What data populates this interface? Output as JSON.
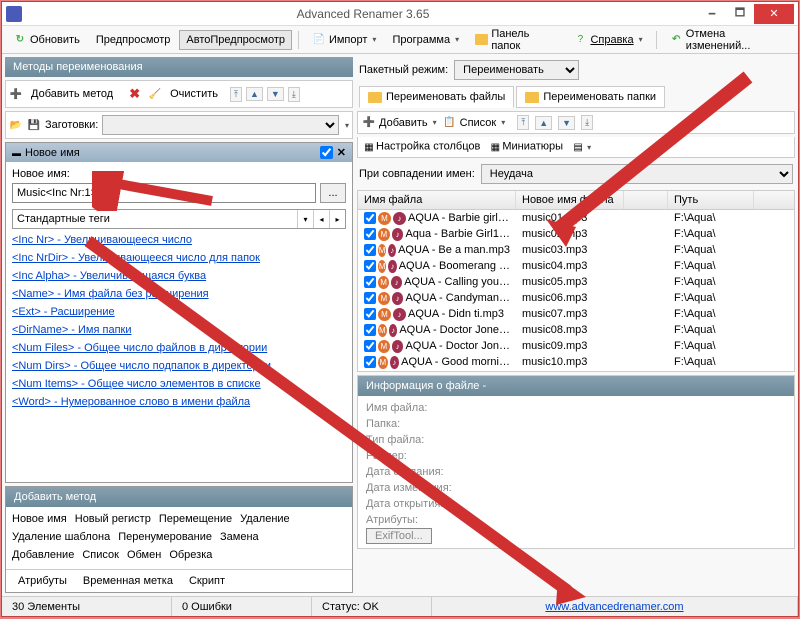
{
  "title": "Advanced Renamer 3.65",
  "toolbar": {
    "refresh": "Обновить",
    "preview": "Предпросмотр",
    "autopreview": "АвтоПредпросмотр",
    "import": "Импорт",
    "program": "Программа",
    "folders_panel": "Панель папок",
    "help": "Справка",
    "undo": "Отмена изменений..."
  },
  "methods": {
    "header": "Методы переименования",
    "add": "Добавить метод",
    "clear": "Очистить",
    "presets_label": "Заготовки:"
  },
  "new_name": {
    "title": "Новое имя",
    "label": "Новое имя:",
    "value": "Music<Inc Nr:1>",
    "dots": "...",
    "std_tags": "Стандартные теги",
    "tags": [
      "<Inc Nr> - Увеличивающееся число",
      "<Inc NrDir> - Увеличивающееся число для папок",
      "<Inc Alpha> - Увеличивающаяся буква",
      "<Name> - Имя файла без расширения",
      "<Ext> - Расширение",
      "<DirName> - Имя папки",
      "<Num Files> - Общее число файлов в директории",
      "<Num Dirs> - Общее число подпапок в директории",
      "<Num Items> - Общее число элементов в списке",
      "<Word> - Нумерованное слово в имени файла"
    ]
  },
  "add_method": {
    "header": "Добавить метод",
    "items": [
      [
        "Новое имя",
        "Новый регистр",
        "Перемещение",
        "Удаление"
      ],
      [
        "Удаление шаблона",
        "Перенумерование",
        "Замена"
      ],
      [
        "Добавление",
        "Список",
        "Обмен",
        "Обрезка"
      ]
    ],
    "tabs": [
      "Атрибуты",
      "Временная метка",
      "Скрипт"
    ]
  },
  "right": {
    "batch_mode": "Пакетный режим:",
    "batch_value": "Переименовать",
    "tab_files": "Переименовать файлы",
    "tab_folders": "Переименовать папки",
    "add": "Добавить",
    "list": "Список",
    "cols": "Настройка столбцов",
    "thumbs": "Миниатюры",
    "match": "При совпадении имен:",
    "match_value": "Неудача"
  },
  "table": {
    "h1": "Имя файла",
    "h2": "Новое имя файла",
    "h3": "",
    "h4": "Путь",
    "rows": [
      {
        "name": "AQUA - Barbie girl…",
        "new": "music01.mp3",
        "path": "F:\\Aqua\\"
      },
      {
        "name": "Aqua - Barbie Girl1…",
        "new": "music02.mp3",
        "path": "F:\\Aqua\\"
      },
      {
        "name": "AQUA - Be a man.mp3",
        "new": "music03.mp3",
        "path": "F:\\Aqua\\"
      },
      {
        "name": "AQUA - Boomerang …",
        "new": "music04.mp3",
        "path": "F:\\Aqua\\"
      },
      {
        "name": "AQUA - Calling you…",
        "new": "music05.mp3",
        "path": "F:\\Aqua\\"
      },
      {
        "name": "AQUA - Candyman…",
        "new": "music06.mp3",
        "path": "F:\\Aqua\\"
      },
      {
        "name": "AQUA - Didn ti.mp3",
        "new": "music07.mp3",
        "path": "F:\\Aqua\\"
      },
      {
        "name": "AQUA - Doctor Jone…",
        "new": "music08.mp3",
        "path": "F:\\Aqua\\"
      },
      {
        "name": "AQUA - Doctor Jon…",
        "new": "music09.mp3",
        "path": "F:\\Aqua\\"
      },
      {
        "name": "AQUA - Good morni…",
        "new": "music10.mp3",
        "path": "F:\\Aqua\\"
      }
    ]
  },
  "file_info": {
    "header": "Информация о файле -",
    "labels": [
      "Имя файла:",
      "Папка:",
      "Тип файла:",
      "Размер:",
      "Дата создания:",
      "Дата изменения:",
      "Дата открытия:",
      "Атрибуты:"
    ],
    "exif": "ExifTool..."
  },
  "status": {
    "elements": "30 Элементы",
    "errors": "0 Ошибки",
    "status": "Статус: OK",
    "url": "www.advancedrenamer.com"
  }
}
